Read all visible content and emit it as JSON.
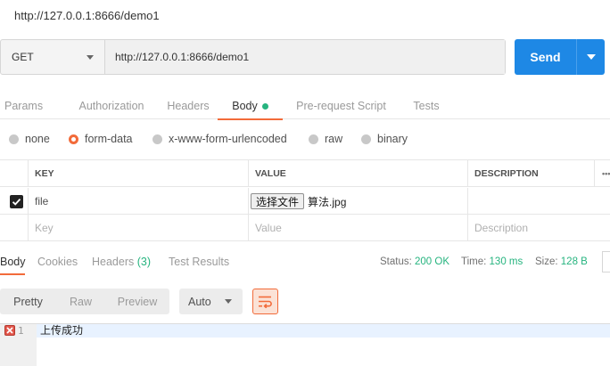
{
  "request": {
    "title": "http://127.0.0.1:8666/demo1",
    "method": "GET",
    "url": "http://127.0.0.1:8666/demo1",
    "send_label": "Send"
  },
  "tabs": [
    "Params",
    "Authorization",
    "Headers",
    "Body",
    "Pre-request Script",
    "Tests"
  ],
  "active_tab": "Body",
  "body_types": [
    "none",
    "form-data",
    "x-www-form-urlencoded",
    "raw",
    "binary"
  ],
  "selected_body_type": "form-data",
  "kv_table": {
    "headers": [
      "KEY",
      "VALUE",
      "DESCRIPTION"
    ],
    "more_label": "•••",
    "row": {
      "checked": true,
      "key": "file",
      "file_button": "选择文件",
      "file_name": "算法.jpg",
      "description": ""
    },
    "placeholders": {
      "key": "Key",
      "value": "Value",
      "description": "Description"
    }
  },
  "response": {
    "tabs": [
      "Body",
      "Cookies",
      "Headers",
      "Test Results"
    ],
    "headers_label": "Headers",
    "headers_count": "(3)",
    "active_tab": "Body",
    "status_label": "Status:",
    "status_value": "200 OK",
    "time_label": "Time:",
    "time_value": "130 ms",
    "size_label": "Size:",
    "size_value": "128 B",
    "formats": [
      "Pretty",
      "Raw",
      "Preview"
    ],
    "active_format": "Pretty",
    "auto_label": "Auto",
    "lines": [
      {
        "number": "1",
        "text": "上传成功"
      }
    ]
  },
  "colors": {
    "accent": "#f26b3a",
    "send": "#1e88e5",
    "success": "#26b47f"
  }
}
